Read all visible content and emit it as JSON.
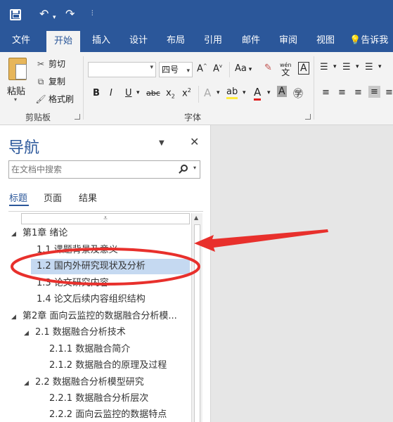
{
  "ribbon_tabs": [
    "文件",
    "开始",
    "插入",
    "设计",
    "布局",
    "引用",
    "邮件",
    "审阅",
    "视图"
  ],
  "tell_me": "告诉我",
  "clipboard": {
    "paste_label": "粘贴",
    "cut_label": "剪切",
    "copy_label": "复制",
    "format_painter_label": "格式刷",
    "group_label": "剪贴板"
  },
  "font": {
    "font_name": "",
    "font_size": "四号",
    "group_label": "字体",
    "case_label": "Aa",
    "phonetic_label": "wén"
  },
  "navigation": {
    "title": "导航",
    "search_placeholder": "在文档中搜索",
    "tabs": [
      "标题",
      "页面",
      "结果"
    ],
    "headings": [
      {
        "text": "第1章 绪论",
        "level": 1,
        "toggle": "◢"
      },
      {
        "text": "1.1 课题背景及意义",
        "level": 2,
        "toggle": ""
      },
      {
        "text": "1.2 国内外研究现状及分析",
        "level": 2,
        "toggle": "",
        "selected": true
      },
      {
        "text": "1.3 论文研究内容",
        "level": 2,
        "toggle": ""
      },
      {
        "text": "1.4 论文后续内容组织结构",
        "level": 2,
        "toggle": ""
      },
      {
        "text": "第2章 面向云监控的数据融合分析模...",
        "level": 1,
        "toggle": "◢"
      },
      {
        "text": "2.1 数据融合分析技术",
        "level": 2,
        "toggle": "◢"
      },
      {
        "text": "2.1.1 数据融合简介",
        "level": 3,
        "toggle": ""
      },
      {
        "text": "2.1.2 数据融合的原理及过程",
        "level": 3,
        "toggle": ""
      },
      {
        "text": "2.2 数据融合分析模型研究",
        "level": 2,
        "toggle": "◢"
      },
      {
        "text": "2.2.1 数据融合分析层次",
        "level": 3,
        "toggle": ""
      },
      {
        "text": "2.2.2 面向云监控的数据特点",
        "level": 3,
        "toggle": ""
      }
    ]
  },
  "annotation_color": "#e8302c",
  "accent_color": "#2b579a"
}
